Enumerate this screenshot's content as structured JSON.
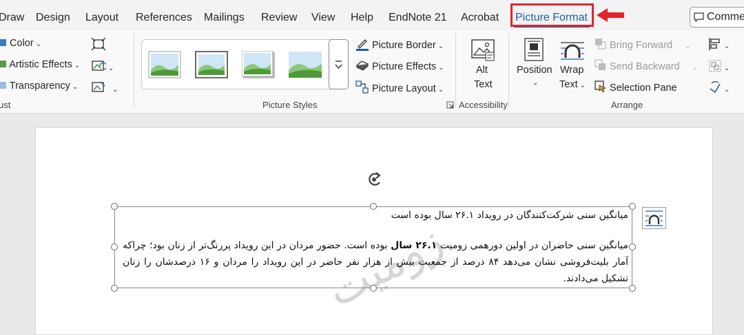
{
  "tabs": [
    "Draw",
    "Design",
    "Layout",
    "References",
    "Mailings",
    "Review",
    "View",
    "Help",
    "EndNote 21",
    "Acrobat",
    "Picture Format"
  ],
  "active_tab": "Picture Format",
  "comments_label": "Comme",
  "ribbon": {
    "adjust": {
      "color": "Color",
      "artistic": "Artistic Effects",
      "transparency": "Transparency",
      "group_label": "ust"
    },
    "picture_styles": {
      "border": "Picture Border",
      "effects": "Picture Effects",
      "layout": "Picture Layout",
      "group_label": "Picture Styles"
    },
    "accessibility": {
      "alt_line1": "Alt",
      "alt_line2": "Text",
      "group_label": "Accessibility"
    },
    "arrange": {
      "position": "Position",
      "wrap_line1": "Wrap",
      "wrap_line2": "Text",
      "bring_forward": "Bring Forward",
      "send_backward": "Send Backward",
      "selection_pane": "Selection Pane",
      "group_label": "Arrange"
    }
  },
  "document": {
    "line1": "میانگین سنی شرکت‌کنندگان در رویداد ۲۶.۱ سال بوده است",
    "para_before_bold": "میانگین سنی حاضران در اولین دورهمی زومیت ",
    "para_bold": "۲۶.۱ سال",
    "para_after_bold": " بوده است. حضور مردان در این رویداد پررنگ‌تر از زنان بود؛ چراکه آمار بلیت‌فروشی نشان می‌دهد ۸۴ درصد از جمعیت بیش از هزار نفر حاضر در این رویداد را مردان و ۱۶ درصدشان را زنان تشکیل می‌دادند.",
    "watermark": "زومیت"
  },
  "colors": {
    "accent": "#1b5fa8",
    "highlight": "#e1242a"
  }
}
